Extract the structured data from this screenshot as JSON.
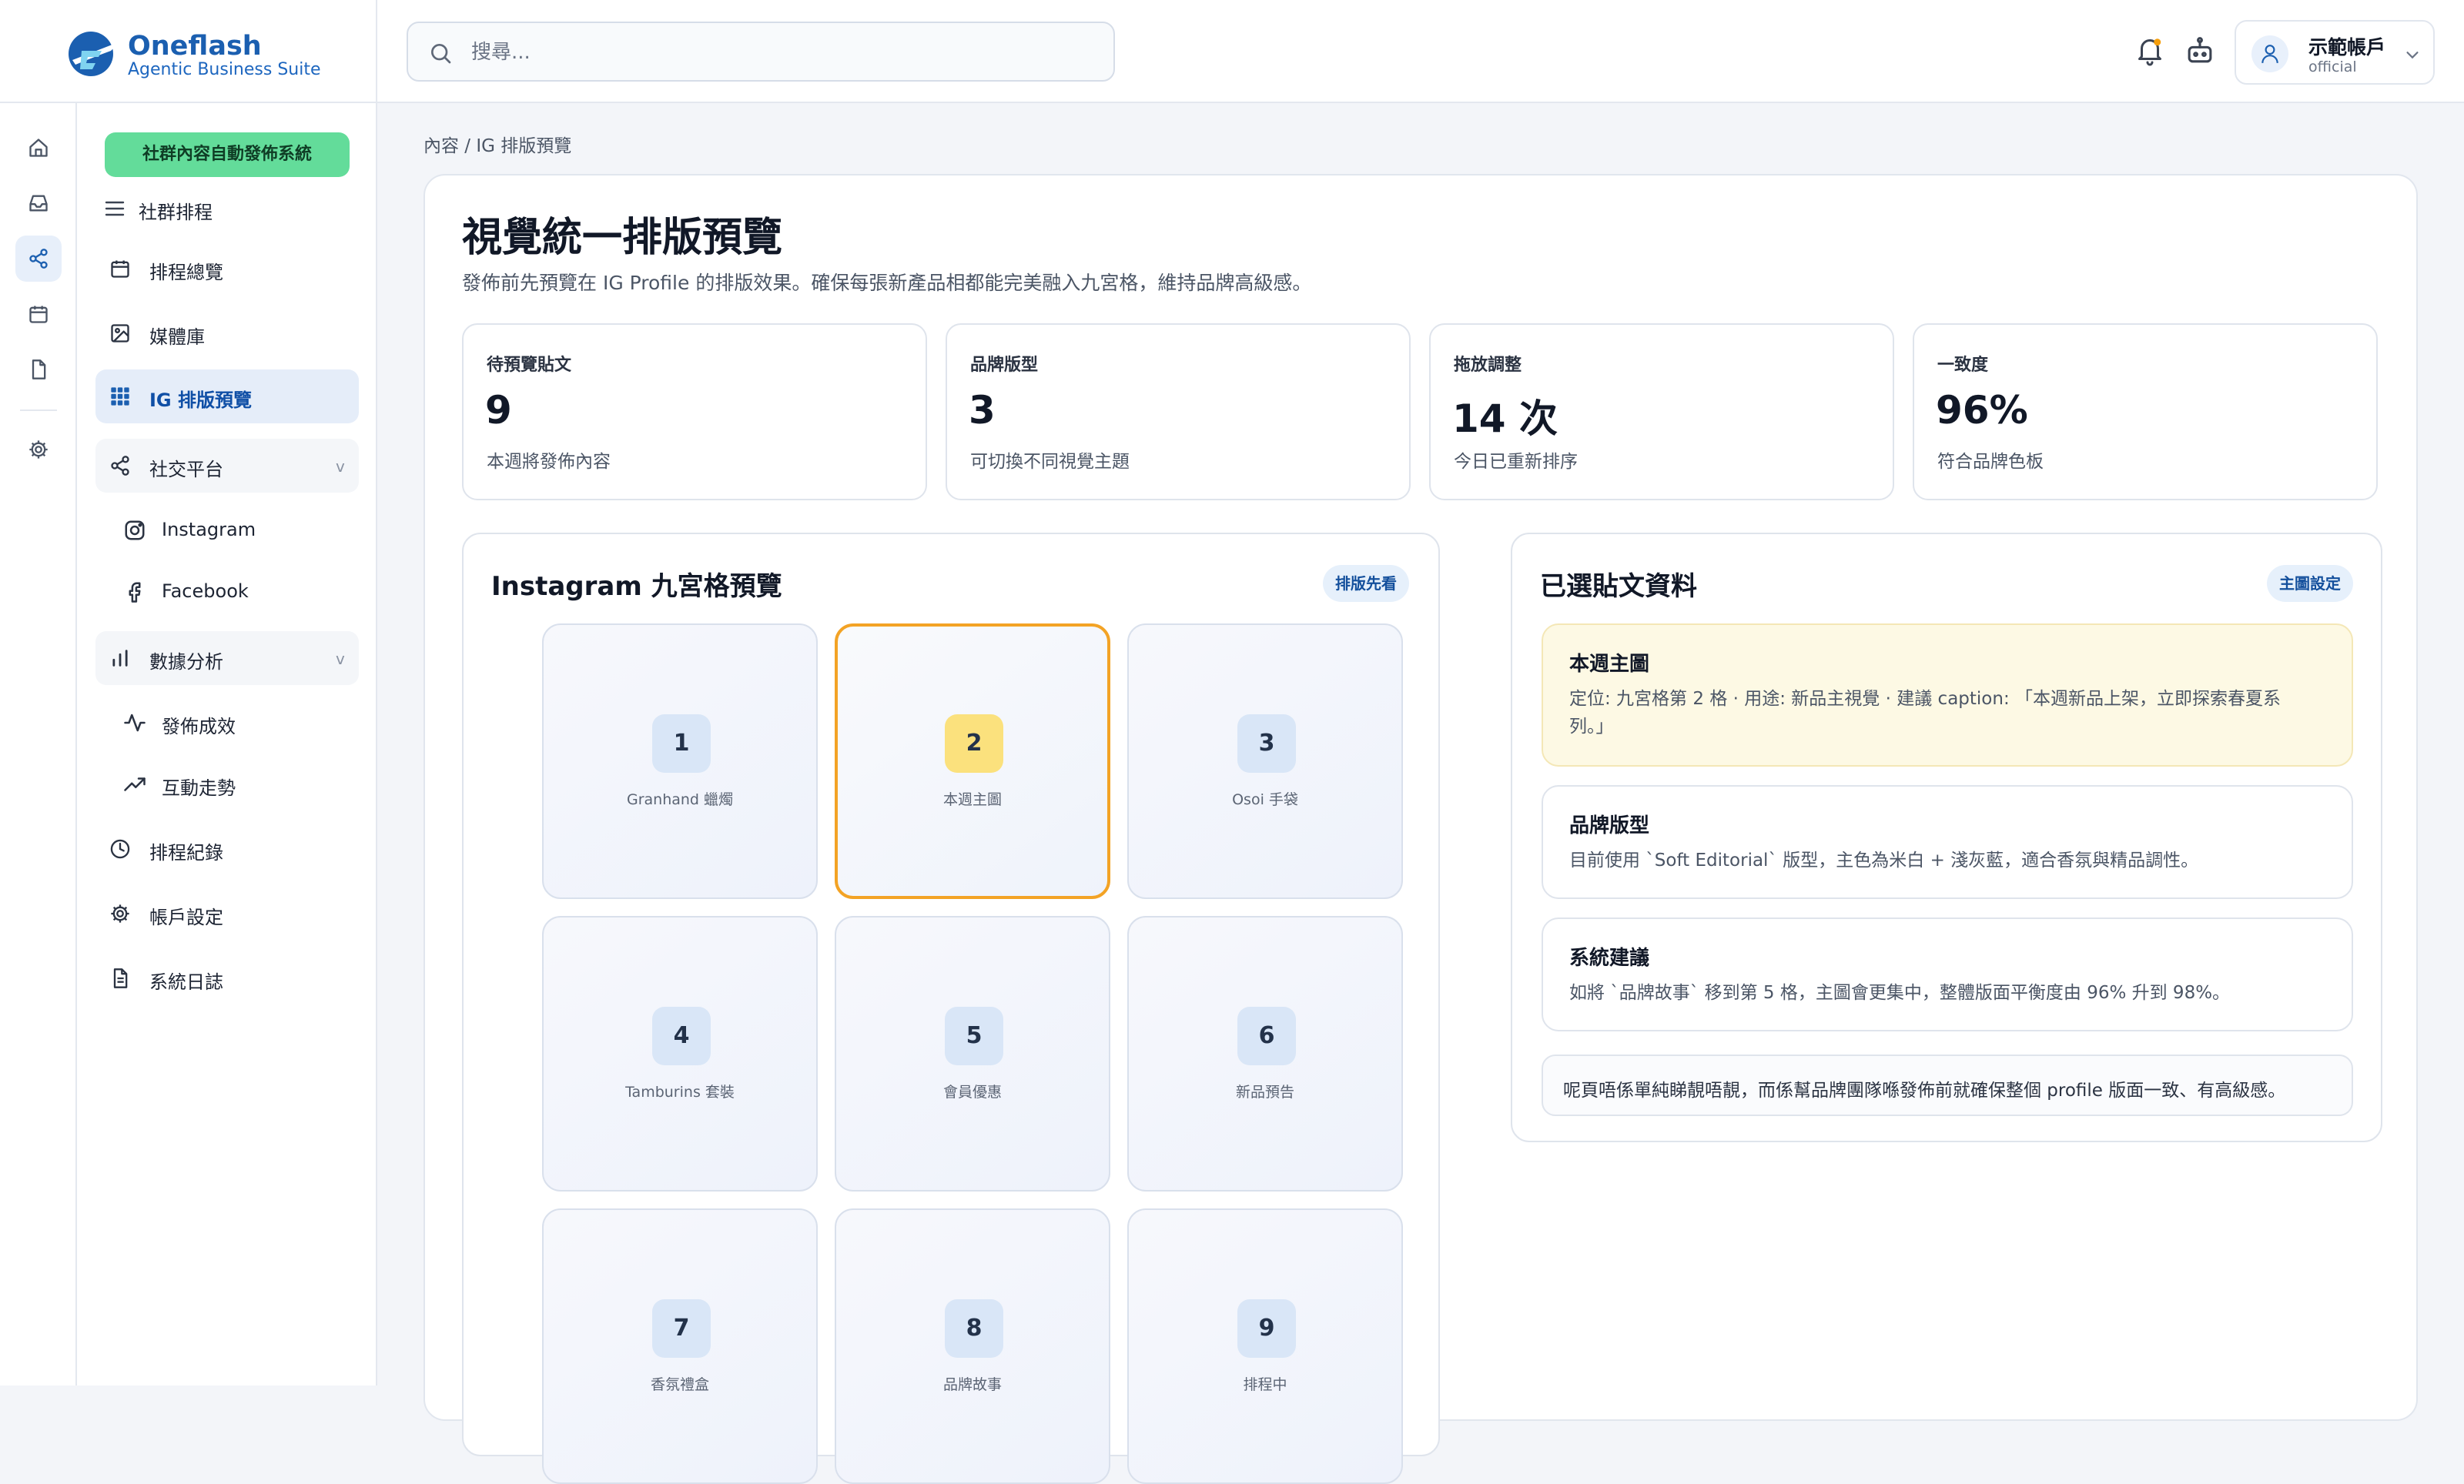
{
  "brand": {
    "name": "Oneflash",
    "tagline": "Agentic Business Suite"
  },
  "search": {
    "placeholder": "搜尋..."
  },
  "account": {
    "name": "示範帳戶",
    "role": "official"
  },
  "sidebar": {
    "system_button": "社群內容自動發佈系統",
    "section_title": "社群排程",
    "items": [
      {
        "label": "排程總覽",
        "icon": "calendar-icon"
      },
      {
        "label": "媒體庫",
        "icon": "image-icon"
      },
      {
        "label": "IG 排版預覽",
        "icon": "grid-icon",
        "active": true
      },
      {
        "label": "社交平台",
        "icon": "share-icon",
        "chevron": "v"
      },
      {
        "label": "Instagram",
        "icon": "instagram-icon"
      },
      {
        "label": "Facebook",
        "icon": "facebook-icon"
      },
      {
        "label": "數據分析",
        "icon": "bar-chart-icon",
        "chevron": "v"
      },
      {
        "label": "發佈成效",
        "icon": "activity-icon"
      },
      {
        "label": "互動走勢",
        "icon": "trending-up-icon"
      },
      {
        "label": "排程紀錄",
        "icon": "clock-icon"
      },
      {
        "label": "帳戶設定",
        "icon": "gear-icon"
      },
      {
        "label": "系統日誌",
        "icon": "file-text-icon"
      }
    ]
  },
  "breadcrumb": "內容 / IG 排版預覽",
  "page": {
    "title": "視覺統一排版預覽",
    "subtitle": "發佈前先預覽在 IG Profile 的排版效果。確保每張新產品相都能完美融入九宮格，維持品牌高級感。"
  },
  "stats": [
    {
      "label": "待預覽貼文",
      "value": "9",
      "desc": "本週將發佈內容"
    },
    {
      "label": "品牌版型",
      "value": "3",
      "desc": "可切換不同視覺主題"
    },
    {
      "label": "拖放調整",
      "value": "14 次",
      "desc": "今日已重新排序"
    },
    {
      "label": "一致度",
      "value": "96%",
      "desc": "符合品牌色板"
    }
  ],
  "grid_panel": {
    "title": "Instagram 九宮格預覽",
    "badge": "排版先看",
    "tiles": [
      {
        "num": "1",
        "caption": "Granhand 蠟燭"
      },
      {
        "num": "2",
        "caption": "本週主圖",
        "selected": true
      },
      {
        "num": "3",
        "caption": "Osoi 手袋"
      },
      {
        "num": "4",
        "caption": "Tamburins 套裝"
      },
      {
        "num": "5",
        "caption": "會員優惠"
      },
      {
        "num": "6",
        "caption": "新品預告"
      },
      {
        "num": "7",
        "caption": "香氛禮盒"
      },
      {
        "num": "8",
        "caption": "品牌故事"
      },
      {
        "num": "9",
        "caption": "排程中"
      }
    ]
  },
  "detail_panel": {
    "title": "已選貼文資料",
    "badge": "主圖設定",
    "cards": [
      {
        "title": "本週主圖",
        "body": "定位: 九宮格第 2 格 · 用途: 新品主視覺 · 建議 caption: 「本週新品上架，立即探索春夏系列。」"
      },
      {
        "title": "品牌版型",
        "body": "目前使用 `Soft Editorial` 版型，主色為米白 + 淺灰藍，適合香氛與精品調性。"
      },
      {
        "title": "系統建議",
        "body": "如將 `品牌故事` 移到第 5 格，主圖會更集中，整體版面平衡度由 96% 升到 98%。"
      }
    ],
    "note": "呢頁唔係單純睇靚唔靚，而係幫品牌團隊喺發佈前就確保整個 profile 版面一致、有高級感。"
  },
  "colors": {
    "accent_blue": "#1b5fb0",
    "system_green": "#63dc9a",
    "selected_tile_border": "#f3a325",
    "selected_number_bg": "#fbe17d",
    "highlight_card_bg": "#fdf9e4",
    "notification_dot": "#f59e0b"
  }
}
